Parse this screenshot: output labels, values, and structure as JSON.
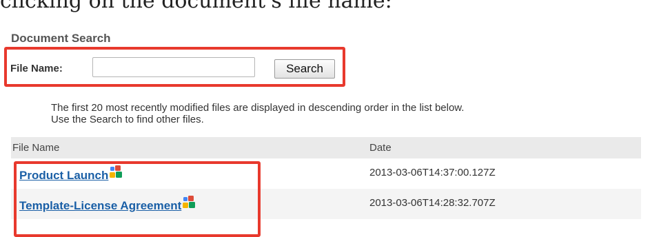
{
  "intro_text": "clicking on the document's file name:",
  "document_search": {
    "title": "Document Search",
    "file_name_label": "File Name:",
    "input_value": "",
    "search_button": "Search"
  },
  "info_lines": [
    "The first 20 most recently modified files are displayed in descending order in the list below.",
    "Use the Search to find other files."
  ],
  "table": {
    "headers": {
      "file_name": "File Name",
      "date": "Date"
    },
    "rows": [
      {
        "name": "Product Launch",
        "date": "2013-03-06T14:37:00.127Z",
        "icon": "google-docs-icon"
      },
      {
        "name": "Template-License Agreement",
        "date": "2013-03-06T14:28:32.707Z",
        "icon": "google-docs-icon"
      }
    ]
  },
  "colors": {
    "highlight": "#e8392d",
    "link": "#1a5fa6"
  }
}
